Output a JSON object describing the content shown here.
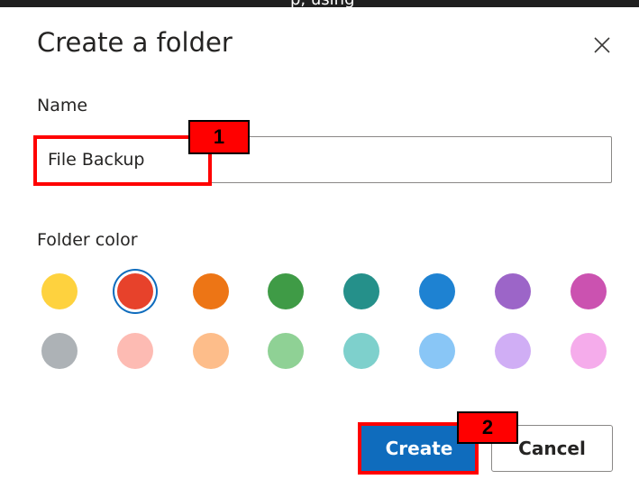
{
  "background_caption": "p, using",
  "dialog": {
    "title": "Create a folder",
    "close_icon": "close-icon"
  },
  "name_field": {
    "label": "Name",
    "value": "File Backup"
  },
  "folder_color": {
    "label": "Folder color",
    "selected_index": 1,
    "colors": [
      "#fed23e",
      "#e7422b",
      "#ed7515",
      "#3f9b46",
      "#25908a",
      "#1e82d2",
      "#9c65c8",
      "#cb52b0",
      "#adb2b6",
      "#fdbbb3",
      "#fdbd8a",
      "#8fd195",
      "#7ed0cc",
      "#89c6f6",
      "#d0aef5",
      "#f5aceb"
    ]
  },
  "buttons": {
    "create_label": "Create",
    "cancel_label": "Cancel"
  },
  "annotations": [
    {
      "number": "1",
      "target": "name_field"
    },
    {
      "number": "2",
      "target": "create_button"
    }
  ],
  "colors": {
    "accent": "#0f6cbd",
    "annotation": "#ff0000"
  }
}
